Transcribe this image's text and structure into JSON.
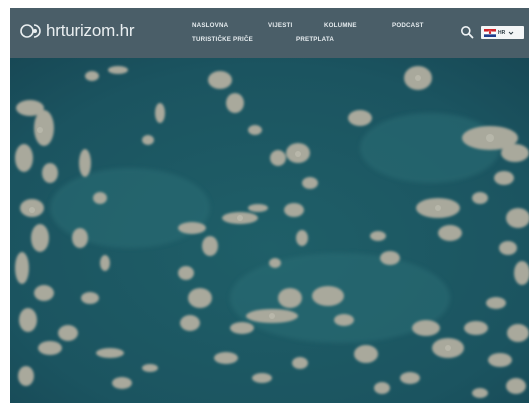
{
  "site": {
    "logo_text": "hrturizom.hr"
  },
  "nav": {
    "row1": [
      "NASLOVNA",
      "VIJESTI",
      "KOLUMNE",
      "PODCAST"
    ],
    "row2": [
      "TURISTIČKE PRIČE",
      "PRETPLATA"
    ]
  },
  "language": {
    "selected": "HR",
    "flag_icon": "croatia-flag-icon"
  },
  "icons": {
    "search": "search-icon",
    "dropdown": "chevron-down-icon"
  },
  "colors": {
    "header_bg": "#4a5e68",
    "sea": "#1d5560",
    "islands": "#a8a89b"
  },
  "hero": {
    "subject": "aerial photo of islands in the sea"
  }
}
